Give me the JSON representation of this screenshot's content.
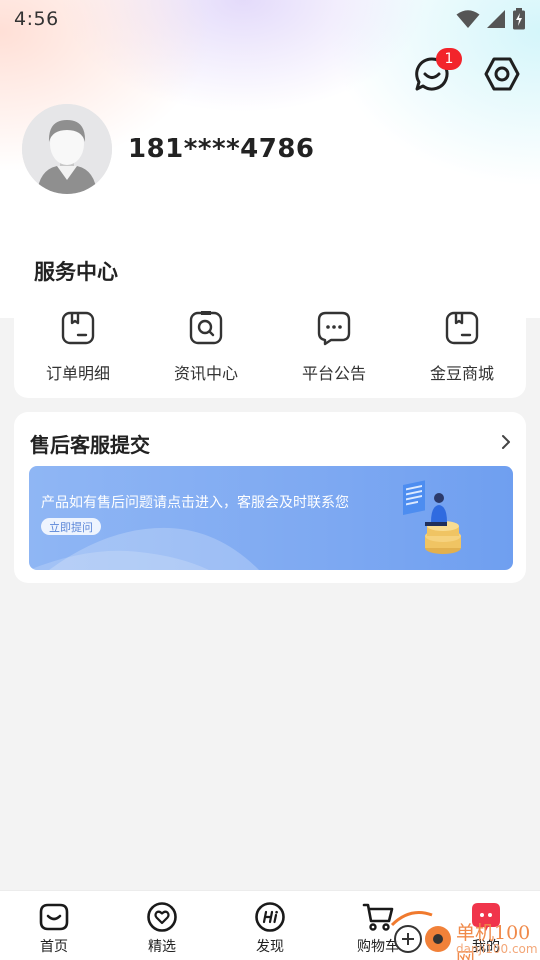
{
  "status_bar": {
    "time": "4:56"
  },
  "header": {
    "message_badge": "1",
    "icons": [
      "message-icon",
      "settings-icon"
    ]
  },
  "profile": {
    "phone": "181****4786"
  },
  "service_center": {
    "title": "服务中心",
    "items": [
      {
        "label": "订单明细",
        "icon": "order-icon"
      },
      {
        "label": "资讯中心",
        "icon": "news-search-icon"
      },
      {
        "label": "平台公告",
        "icon": "announcement-icon"
      },
      {
        "label": "金豆商城",
        "icon": "mall-icon"
      }
    ]
  },
  "after_sales": {
    "title": "售后客服提交",
    "banner_text": "产品如有售后问题请点击进入，客服会及时联系您",
    "banner_button": "立即提问"
  },
  "tab_bar": {
    "items": [
      {
        "label": "首页",
        "icon": "home-icon"
      },
      {
        "label": "精选",
        "icon": "heart-icon"
      },
      {
        "label": "发现",
        "icon": "hi-icon"
      },
      {
        "label": "购物车",
        "icon": "cart-icon"
      },
      {
        "label": "我的",
        "icon": "profile-icon"
      }
    ]
  },
  "watermark": {
    "line1": "单机100网",
    "line2": "danji100.com"
  },
  "colors": {
    "badge": "#f2242b",
    "banner": "#7ea9f2",
    "accent_red": "#f0354b"
  }
}
